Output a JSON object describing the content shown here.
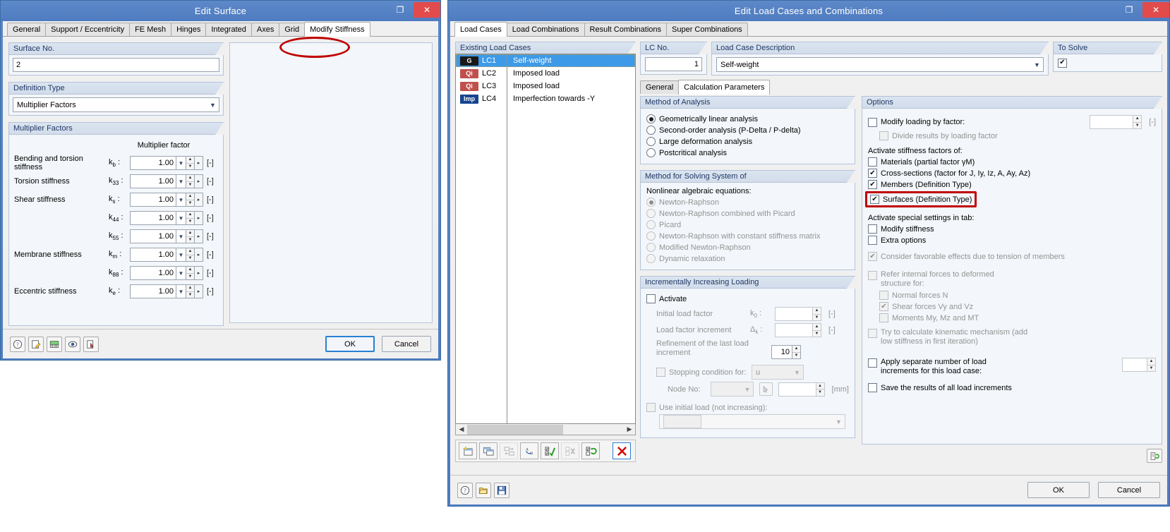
{
  "left_dialog": {
    "title": "Edit Surface",
    "window_buttons": {
      "restore": "❐",
      "close": "✕"
    },
    "tabs": [
      {
        "label": "General",
        "active": false
      },
      {
        "label": "Support / Eccentricity",
        "active": false
      },
      {
        "label": "FE Mesh",
        "active": false
      },
      {
        "label": "Hinges",
        "active": false
      },
      {
        "label": "Integrated",
        "active": false
      },
      {
        "label": "Axes",
        "active": false
      },
      {
        "label": "Grid",
        "active": false
      },
      {
        "label": "Modify Stiffness",
        "active": true
      }
    ],
    "surface_no": {
      "caption": "Surface No.",
      "value": "2"
    },
    "definition_type": {
      "caption": "Definition Type",
      "value": "Multiplier Factors"
    },
    "multiplier_factors": {
      "caption": "Multiplier Factors",
      "column_header": "Multiplier factor",
      "unit": "[-]",
      "rows": [
        {
          "label": "Bending and torsion stiffness",
          "symbol": "k",
          "sub": "b",
          "value": "1.00"
        },
        {
          "label": "Torsion stiffness",
          "symbol": "k",
          "sub": "33",
          "value": "1.00"
        },
        {
          "label": "Shear stiffness",
          "symbol": "k",
          "sub": "s",
          "value": "1.00"
        },
        {
          "label": "",
          "symbol": "k",
          "sub": "44",
          "value": "1.00"
        },
        {
          "label": "",
          "symbol": "k",
          "sub": "55",
          "value": "1.00"
        },
        {
          "label": "Membrane stiffness",
          "symbol": "k",
          "sub": "m",
          "value": "1.00"
        },
        {
          "label": "",
          "symbol": "k",
          "sub": "88",
          "value": "1.00"
        },
        {
          "label": "Eccentric stiffness",
          "symbol": "k",
          "sub": "e",
          "value": "1.00"
        }
      ]
    },
    "footer": {
      "icons": [
        "help-icon",
        "edit-icon",
        "units-icon",
        "view-icon",
        "pick-icon"
      ],
      "ok": "OK",
      "cancel": "Cancel"
    }
  },
  "right_dialog": {
    "title": "Edit Load Cases and Combinations",
    "window_buttons": {
      "restore": "❐",
      "close": "✕"
    },
    "tabs": [
      {
        "label": "Load Cases",
        "active": true
      },
      {
        "label": "Load Combinations",
        "active": false
      },
      {
        "label": "Result Combinations",
        "active": false
      },
      {
        "label": "Super Combinations",
        "active": false
      }
    ],
    "existing_load_cases": {
      "caption": "Existing Load Cases",
      "rows": [
        {
          "badge": "G",
          "badge_color": "#1a1a1a",
          "id": "LC1",
          "description": "Self-weight",
          "selected": true
        },
        {
          "badge": "Qi",
          "badge_color": "#c0504d",
          "id": "LC2",
          "description": "Imposed load",
          "selected": false
        },
        {
          "badge": "Qi",
          "badge_color": "#c0504d",
          "id": "LC3",
          "description": "Imposed load",
          "selected": false
        },
        {
          "badge": "Imp",
          "badge_color": "#17458f",
          "id": "LC4",
          "description": "Imperfection towards -Y",
          "selected": false
        }
      ],
      "toolbar_icons": [
        "new-load-case-icon",
        "copy-load-case-icon",
        "renumber-icon",
        "rename-icon",
        "select-all-icon",
        "deselect-all-icon",
        "refresh-icon",
        "delete-icon"
      ]
    },
    "lc_no": {
      "caption": "LC No.",
      "value": "1"
    },
    "load_case_description": {
      "caption": "Load Case Description",
      "value": "Self-weight"
    },
    "to_solve": {
      "caption": "To Solve",
      "checked": true
    },
    "sub_tabs": [
      {
        "label": "General",
        "active": false
      },
      {
        "label": "Calculation Parameters",
        "active": true
      }
    ],
    "method_of_analysis": {
      "caption": "Method of Analysis",
      "options": [
        {
          "label": "Geometrically linear analysis",
          "selected": true,
          "disabled": false
        },
        {
          "label": "Second-order analysis (P-Delta / P-delta)",
          "selected": false,
          "disabled": false
        },
        {
          "label": "Large deformation analysis",
          "selected": false,
          "disabled": false
        },
        {
          "label": "Postcritical analysis",
          "selected": false,
          "disabled": false
        }
      ]
    },
    "method_solving": {
      "caption": "Method for Solving System of",
      "subtitle": "Nonlinear algebraic equations:",
      "options": [
        {
          "label": "Newton-Raphson",
          "selected": true,
          "disabled": true
        },
        {
          "label": "Newton-Raphson combined with Picard",
          "selected": false,
          "disabled": true
        },
        {
          "label": "Picard",
          "selected": false,
          "disabled": true
        },
        {
          "label": "Newton-Raphson with constant stiffness matrix",
          "selected": false,
          "disabled": true
        },
        {
          "label": "Modified Newton-Raphson",
          "selected": false,
          "disabled": true
        },
        {
          "label": "Dynamic relaxation",
          "selected": false,
          "disabled": true
        }
      ]
    },
    "incremental_loading": {
      "caption": "Incrementally Increasing Loading",
      "activate": {
        "label": "Activate",
        "checked": false
      },
      "initial_load_factor": {
        "label": "Initial load factor",
        "symbol": "k",
        "sub": "0",
        "value": "",
        "unit": "[-]"
      },
      "load_factor_increment": {
        "label": "Load factor increment",
        "symbol": "Δk",
        "sub": "",
        "value": "",
        "unit": "[-]"
      },
      "refinement": {
        "label": "Refinement of the last load increment",
        "value": "10"
      },
      "stopping_condition": {
        "label": "Stopping condition for:",
        "checked": false,
        "value": "u"
      },
      "node_no": {
        "label": "Node No:",
        "value": "",
        "unit": "[mm]"
      },
      "use_initial_load": {
        "label": "Use initial load (not increasing):",
        "checked": false,
        "value": ""
      }
    },
    "options": {
      "caption": "Options",
      "modify_loading": {
        "label": "Modify loading by factor:",
        "checked": false,
        "value": "",
        "unit": "[-]"
      },
      "divide_results": {
        "label": "Divide results by loading factor",
        "checked": false,
        "disabled": true
      },
      "activate_stiffness_title": "Activate stiffness factors of:",
      "stiffness_items": [
        {
          "label": "Materials (partial factor γM)",
          "checked": false,
          "highlighted": false
        },
        {
          "label": "Cross-sections (factor for J, Iy, Iz, A, Ay, Az)",
          "checked": true,
          "highlighted": false
        },
        {
          "label": "Members (Definition Type)",
          "checked": true,
          "highlighted": false
        },
        {
          "label": "Surfaces (Definition Type)",
          "checked": true,
          "highlighted": true
        }
      ],
      "special_settings_title": "Activate special settings in tab:",
      "special_items": [
        {
          "label": "Modify stiffness",
          "checked": false,
          "disabled": false
        },
        {
          "label": "Extra options",
          "checked": false,
          "disabled": false
        }
      ],
      "consider_favorable": {
        "label": "Consider favorable effects due to tension of members",
        "checked": true,
        "disabled": true
      },
      "refer_internal": {
        "label": "Refer internal forces to deformed structure for:",
        "checked": false,
        "disabled": true
      },
      "refer_sub_items": [
        {
          "label": "Normal forces N",
          "checked": false,
          "disabled": true
        },
        {
          "label": "Shear forces Vy and Vz",
          "checked": true,
          "disabled": true
        },
        {
          "label": "Moments My, Mz and MT",
          "checked": false,
          "disabled": true
        }
      ],
      "kinematic": {
        "label": "Try to calculate kinematic mechanism (add low stiffness in first iteration)",
        "checked": false,
        "disabled": true
      },
      "apply_separate": {
        "label": "Apply separate number of load increments for this load case:",
        "checked": false,
        "value": ""
      },
      "save_results": {
        "label": "Save the results of all load increments",
        "checked": false
      }
    },
    "footer": {
      "icons": [
        "help-icon",
        "open-icon",
        "save-icon"
      ],
      "settings_icon": "settings-icon",
      "ok": "OK",
      "cancel": "Cancel"
    }
  }
}
